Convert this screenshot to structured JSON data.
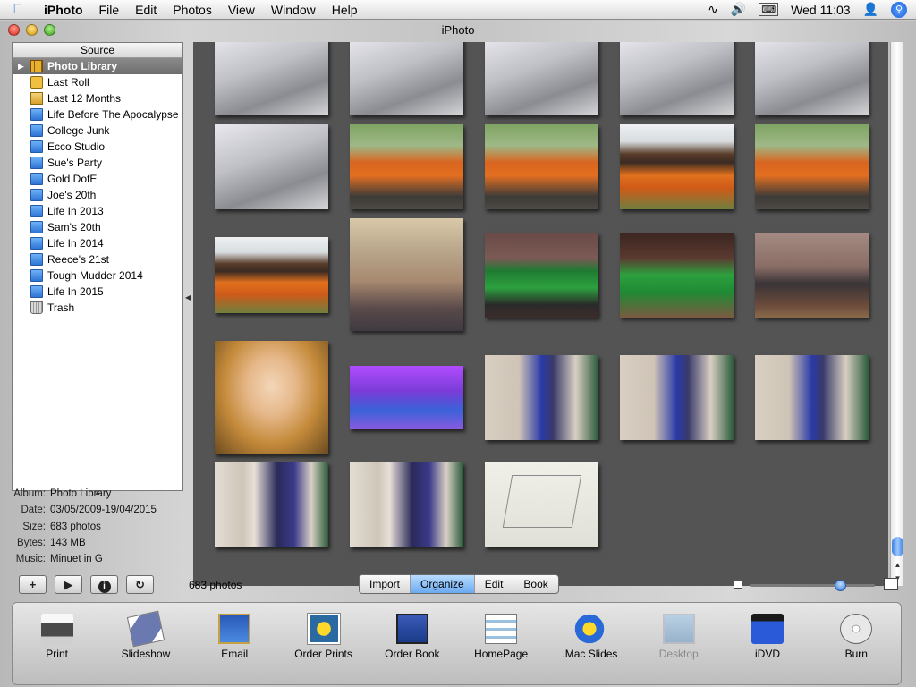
{
  "menubar": {
    "app_name": "iPhoto",
    "menus": [
      "File",
      "Edit",
      "Photos",
      "View",
      "Window",
      "Help"
    ],
    "clock": "Wed 11:03",
    "icons": [
      "apple-icon",
      "bluetooth-icon",
      "volume-icon",
      "keyboard-layout-icon",
      "user-icon",
      "spotlight-icon"
    ]
  },
  "window": {
    "title": "iPhoto"
  },
  "source": {
    "header": "Source",
    "items": [
      {
        "label": "Photo Library",
        "icon": "photo-library-icon",
        "selected": true
      },
      {
        "label": "Last Roll",
        "icon": "film-roll-icon"
      },
      {
        "label": "Last 12 Months",
        "icon": "calendar-icon"
      },
      {
        "label": "Life Before The Apocalypse",
        "icon": "album-icon"
      },
      {
        "label": "College Junk",
        "icon": "album-icon"
      },
      {
        "label": "Ecco Studio",
        "icon": "album-icon"
      },
      {
        "label": "Sue's Party",
        "icon": "album-icon"
      },
      {
        "label": "Gold DofE",
        "icon": "album-icon"
      },
      {
        "label": "Joe's 20th",
        "icon": "album-icon"
      },
      {
        "label": "Life In 2013",
        "icon": "album-icon"
      },
      {
        "label": "Sam's 20th",
        "icon": "album-icon"
      },
      {
        "label": "Life In 2014",
        "icon": "album-icon"
      },
      {
        "label": "Reece's 21st",
        "icon": "album-icon"
      },
      {
        "label": "Tough Mudder 2014",
        "icon": "album-icon"
      },
      {
        "label": "Life In 2015",
        "icon": "album-icon"
      },
      {
        "label": "Trash",
        "icon": "trash-icon"
      }
    ]
  },
  "info": {
    "album_label": "Album:",
    "album": "Photo Library",
    "date_label": "Date:",
    "date": "03/05/2009-19/04/2015",
    "size_label": "Size:",
    "size": "683 photos",
    "bytes_label": "Bytes:",
    "bytes": "143 MB",
    "music_label": "Music:",
    "music": "Minuet in G"
  },
  "photos": [
    "ramp-climb-1",
    "ramp-climb-2",
    "ramp-climb-3",
    "ramp-climb-4",
    "ramp-climb-5",
    "ramp-climb-6",
    "orange-team-crowd-1",
    "orange-team-crowd-2",
    "orange-team-barrel",
    "orange-team-field",
    "orange-team-banner",
    "dog-on-bed",
    "pool-table-1",
    "pool-table-2",
    "tv-room",
    "selfie-blonde",
    "purple-lit-group",
    "couple-living-room-1",
    "couple-living-room-2",
    "couple-living-room-3",
    "two-guys-door",
    "guys-piggyback",
    "paper-diagram"
  ],
  "controls": {
    "add_icon": "plus-icon",
    "play_icon": "play-icon",
    "info_icon": "info-icon",
    "rotate_icon": "rotate-icon",
    "count": "683 photos",
    "modes": [
      "Import",
      "Organize",
      "Edit",
      "Book"
    ],
    "active_mode": "Organize",
    "zoom_level": 0.72
  },
  "toolbar": {
    "items": [
      {
        "label": "Print",
        "icon": "printer-icon"
      },
      {
        "label": "Slideshow",
        "icon": "slideshow-icon"
      },
      {
        "label": "Email",
        "icon": "email-stamp-icon"
      },
      {
        "label": "Order Prints",
        "icon": "order-prints-icon"
      },
      {
        "label": "Order Book",
        "icon": "order-book-icon"
      },
      {
        "label": "HomePage",
        "icon": "homepage-icon"
      },
      {
        "label": ".Mac Slides",
        "icon": "mac-slides-icon"
      },
      {
        "label": "Desktop",
        "icon": "desktop-icon",
        "disabled": true
      },
      {
        "label": "iDVD",
        "icon": "idvd-icon"
      },
      {
        "label": "Burn",
        "icon": "burn-disc-icon"
      }
    ]
  },
  "colors": {
    "grid_background": "#545454",
    "selection": "#7b7b7b",
    "accent": "#2f74d6"
  }
}
